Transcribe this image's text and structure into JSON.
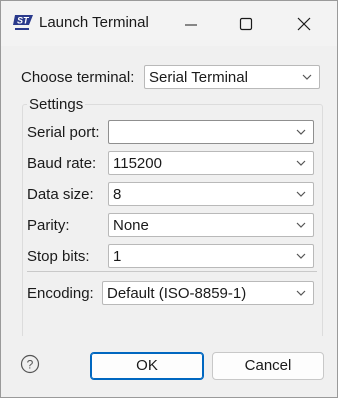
{
  "window": {
    "title": "Launch Terminal"
  },
  "form": {
    "choose_terminal": {
      "label": "Choose terminal:",
      "value": "Serial Terminal"
    },
    "settings_title": "Settings",
    "serial_port": {
      "label": "Serial port:",
      "value": ""
    },
    "baud_rate": {
      "label": "Baud rate:",
      "value": "115200"
    },
    "data_size": {
      "label": "Data size:",
      "value": "8"
    },
    "parity": {
      "label": "Parity:",
      "value": "None"
    },
    "stop_bits": {
      "label": "Stop bits:",
      "value": "1"
    },
    "encoding": {
      "label": "Encoding:",
      "value": "Default (ISO-8859-1)"
    }
  },
  "buttons": {
    "ok": "OK",
    "cancel": "Cancel"
  },
  "icons": {
    "app": "st-logo-icon",
    "help": "help-icon",
    "dropdown": "chevron-down-icon"
  },
  "colors": {
    "accent": "#0067c0",
    "logo": "#2a3a8c"
  }
}
